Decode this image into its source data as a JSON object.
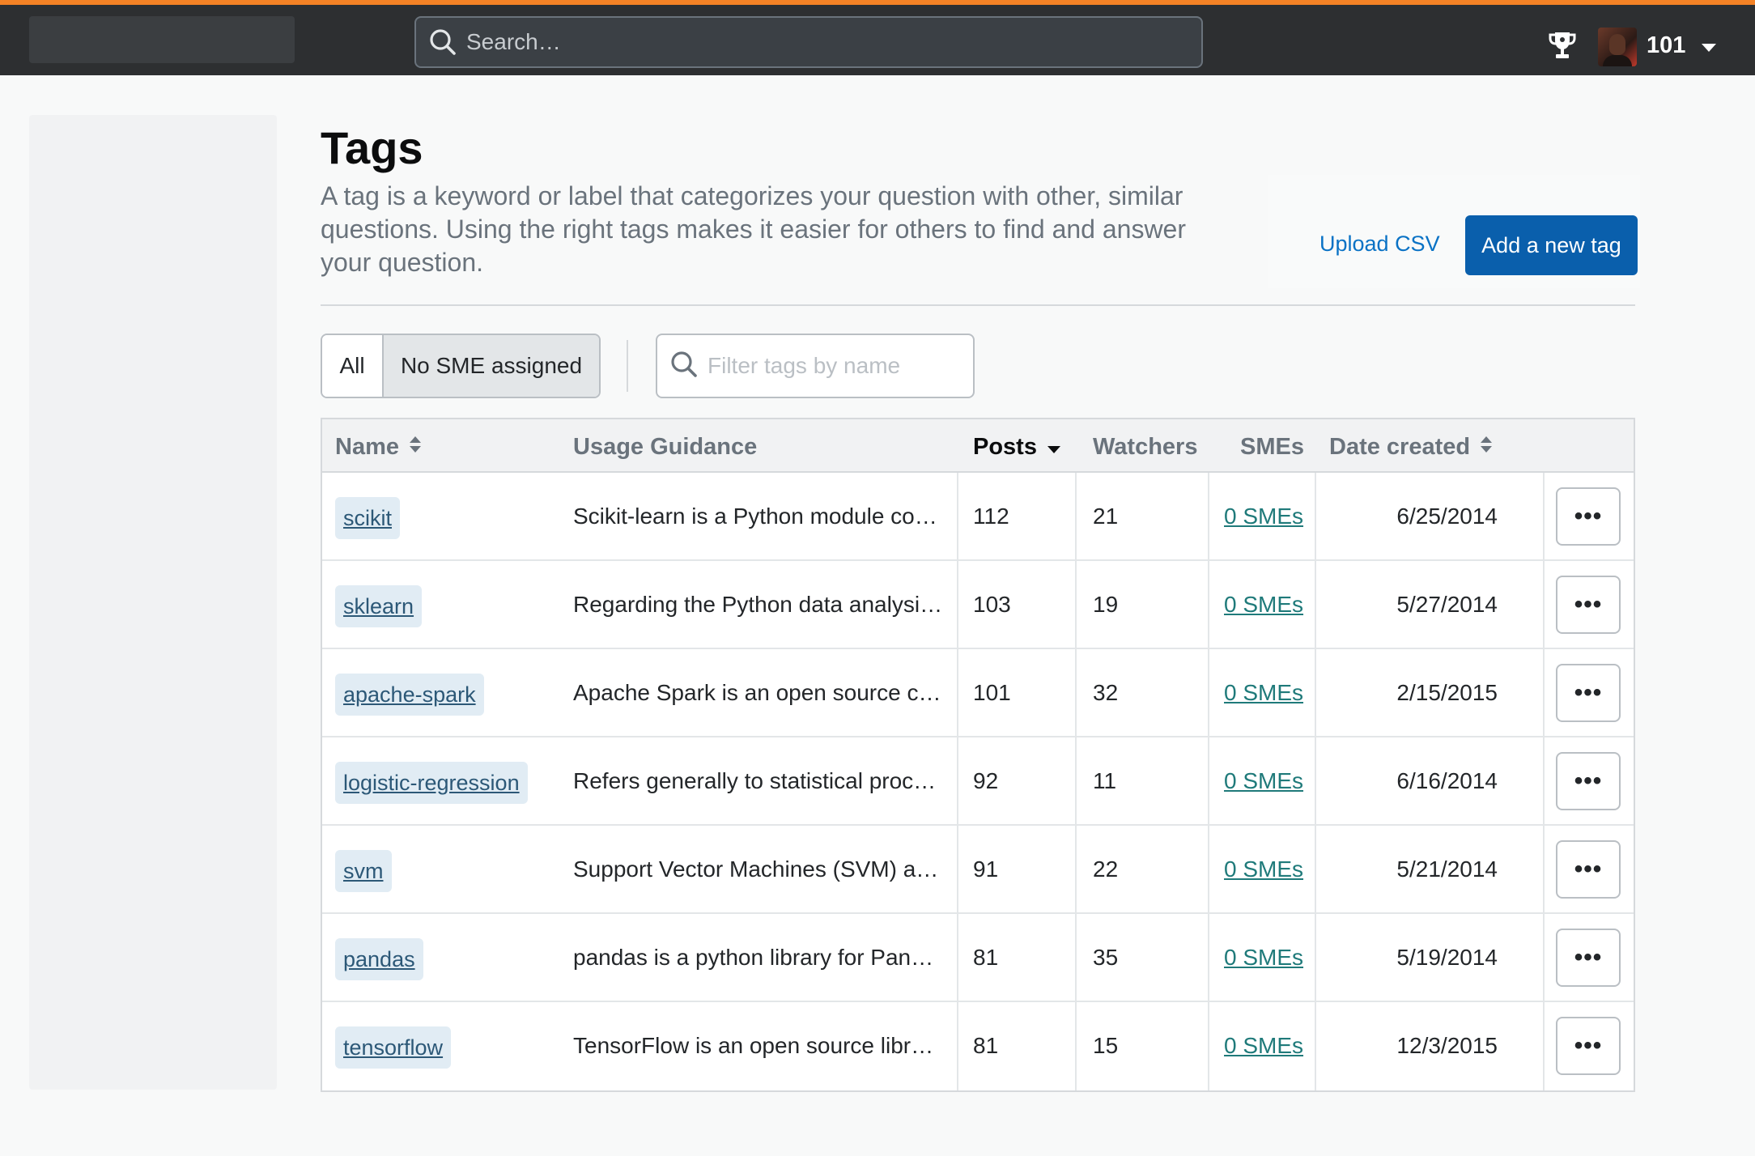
{
  "header": {
    "search_placeholder": "Search…",
    "reputation": "101",
    "icons": [
      "search-icon",
      "trophy-icon",
      "avatar",
      "chevron-down-icon"
    ]
  },
  "page": {
    "title": "Tags",
    "description": "A tag is a keyword or label that categorizes your question with other, similar questions. Using the right tags makes it easier for others to find and answer your question.",
    "upload_csv": "Upload CSV",
    "add_tag": "Add a new tag"
  },
  "filters": {
    "all": "All",
    "no_sme": "No SME assigned",
    "filter_placeholder": "Filter tags by name",
    "selected": "No SME assigned"
  },
  "table": {
    "headers": {
      "name": "Name",
      "guidance": "Usage Guidance",
      "posts": "Posts",
      "watchers": "Watchers",
      "smes": "SMEs",
      "date": "Date created"
    },
    "more_label": "•••",
    "rows": [
      {
        "tag": "scikit",
        "guidance": "Scikit-learn is a Python module co…",
        "posts": "112",
        "watchers": "21",
        "smes": "0 SMEs",
        "date": "6/25/2014"
      },
      {
        "tag": "sklearn",
        "guidance": "Regarding the Python data analysi…",
        "posts": "103",
        "watchers": "19",
        "smes": "0 SMEs",
        "date": "5/27/2014"
      },
      {
        "tag": "apache-spark",
        "guidance": "Apache Spark is an open source c…",
        "posts": "101",
        "watchers": "32",
        "smes": "0 SMEs",
        "date": "2/15/2015"
      },
      {
        "tag": "logistic-regression",
        "guidance": "Refers generally to statistical proc…",
        "posts": "92",
        "watchers": "11",
        "smes": "0 SMEs",
        "date": "6/16/2014"
      },
      {
        "tag": "svm",
        "guidance": "Support Vector Machines (SVM) a…",
        "posts": "91",
        "watchers": "22",
        "smes": "0 SMEs",
        "date": "5/21/2014"
      },
      {
        "tag": "pandas",
        "guidance": "pandas is a python library for Pan…",
        "posts": "81",
        "watchers": "35",
        "smes": "0 SMEs",
        "date": "5/19/2014"
      },
      {
        "tag": "tensorflow",
        "guidance": "TensorFlow is an open source libr…",
        "posts": "81",
        "watchers": "15",
        "smes": "0 SMEs",
        "date": "12/3/2015"
      }
    ]
  },
  "colors": {
    "accent_orange": "#f48225",
    "topbar": "#2d2f31",
    "primary_button": "#0a5fac",
    "link": "#0a72c5",
    "tag_bg": "#e1ecf4",
    "tag_text": "#2c5877",
    "sme_link": "#1f7a7a"
  }
}
